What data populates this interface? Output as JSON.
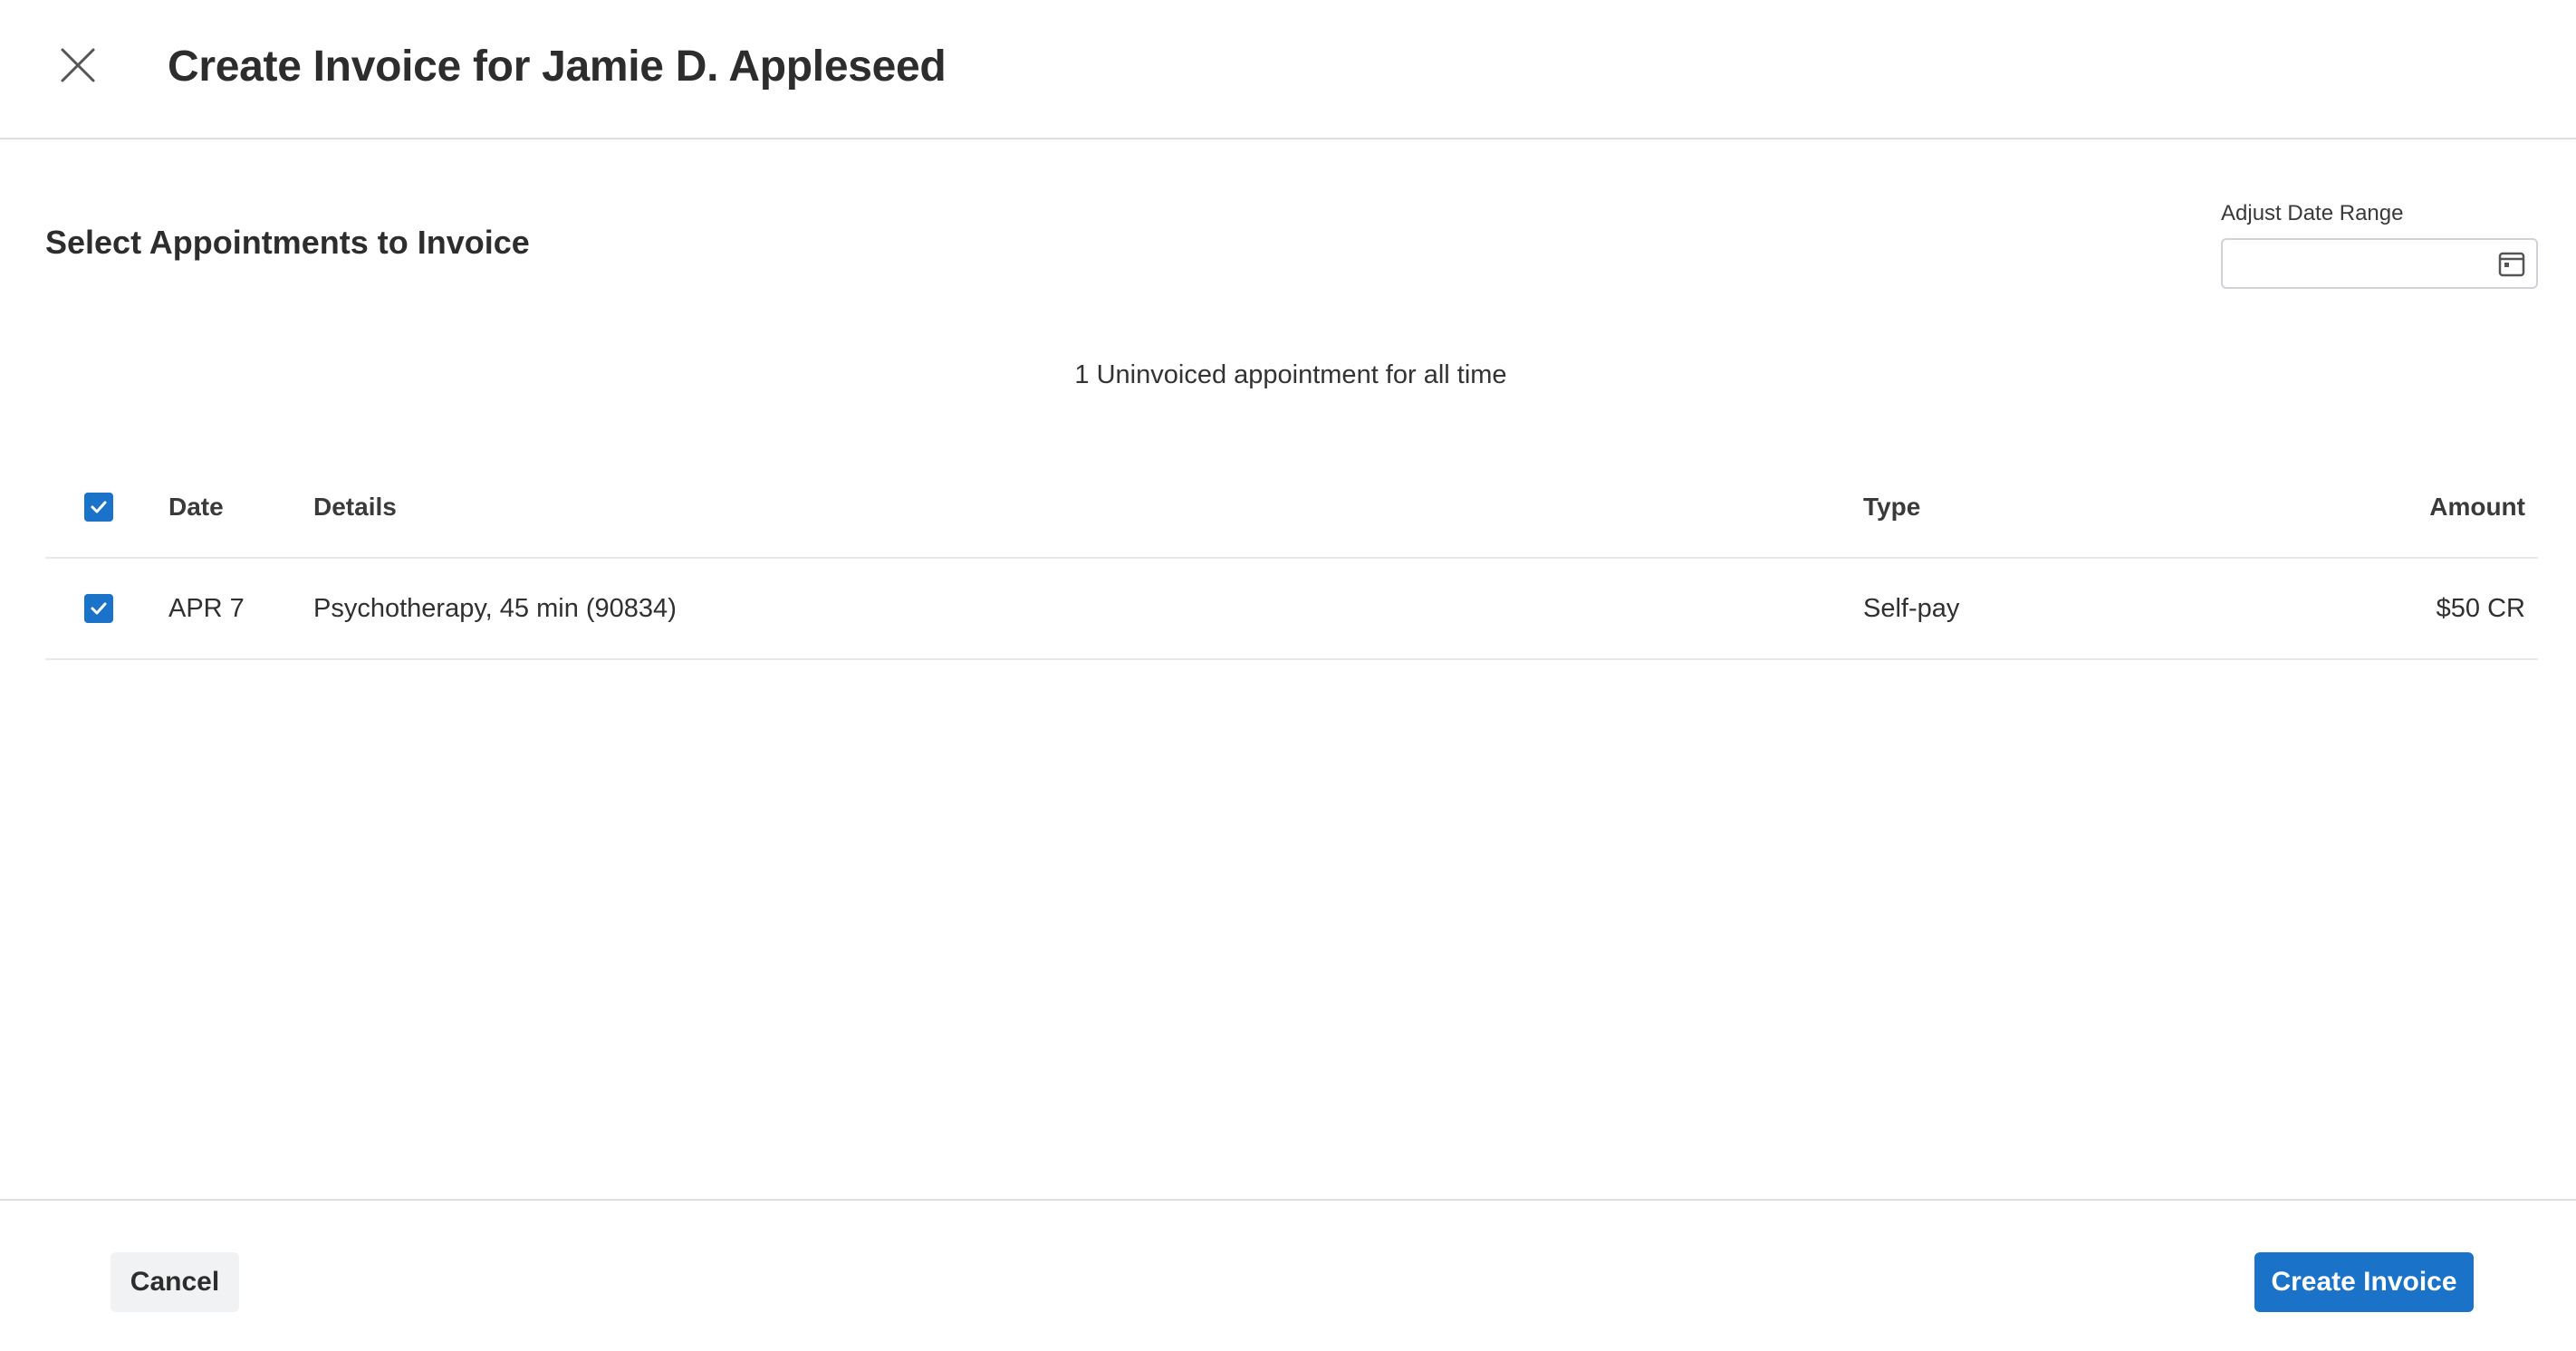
{
  "header": {
    "title": "Create Invoice for Jamie D. Appleseed",
    "close_icon": "close-icon"
  },
  "section": {
    "title": "Select Appointments to Invoice"
  },
  "date_range": {
    "label": "Adjust Date Range",
    "value": "",
    "icon": "calendar-icon"
  },
  "summary": "1 Uninvoiced appointment for all time",
  "table": {
    "select_all_checked": true,
    "columns": [
      "Date",
      "Details",
      "Type",
      "Amount"
    ],
    "rows": [
      {
        "checked": true,
        "date": "APR 7",
        "details": "Psychotherapy, 45 min (90834)",
        "type": "Self-pay",
        "amount": "$50 CR"
      }
    ]
  },
  "footer": {
    "cancel_label": "Cancel",
    "create_label": "Create Invoice"
  },
  "colors": {
    "accent": "#1a73c8",
    "text": "#2d2d2d",
    "border": "#dcdfe3",
    "secondary_button": "#f1f2f3"
  }
}
